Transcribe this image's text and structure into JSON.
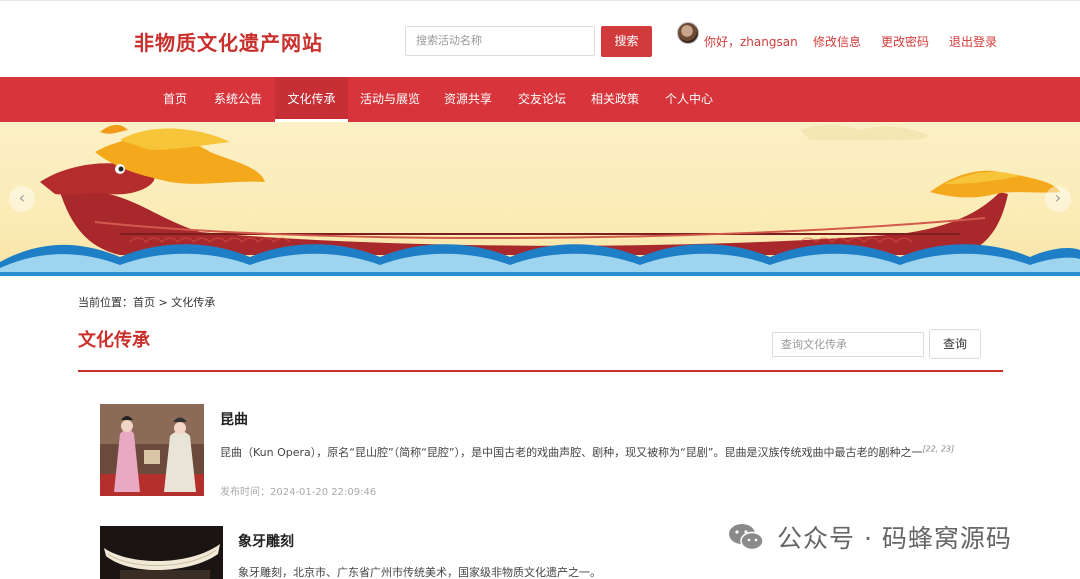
{
  "header": {
    "logo": "非物质文化遗产网站",
    "search_placeholder": "搜索活动名称",
    "search_button": "搜索",
    "greeting": "你好，zhangsan",
    "links": [
      "修改信息",
      "更改密码",
      "退出登录"
    ]
  },
  "nav": {
    "items": [
      "首页",
      "系统公告",
      "文化传承",
      "活动与展览",
      "资源共享",
      "交友论坛",
      "相关政策",
      "个人中心"
    ],
    "active": "文化传承"
  },
  "banner": {
    "prev": "‹",
    "next": "›"
  },
  "breadcrumb": "当前位置：首页 > 文化传承",
  "page_title": "文化传承",
  "filter": {
    "placeholder": "查询文化传承",
    "button": "查询"
  },
  "items": [
    {
      "title": "昆曲",
      "desc": "昆曲（Kun Opera），原名“昆山腔”（简称“昆腔”），是中国古老的戏曲声腔、剧种，现又被称为“昆剧”。昆曲是汉族传统戏曲中最古老的剧种之一",
      "refs": "[22, 23]",
      "date_label": "发布时间：",
      "date": "2024-01-20 22:09:46"
    },
    {
      "title": "象牙雕刻",
      "desc": "象牙雕刻，北京市、广东省广州市传统美术，国家级非物质文化遗产之一。"
    }
  ],
  "watermark": "公众号 · 码蜂窝源码",
  "colors": {
    "brand_red": "#d7353b",
    "title_red": "#c9302c"
  }
}
